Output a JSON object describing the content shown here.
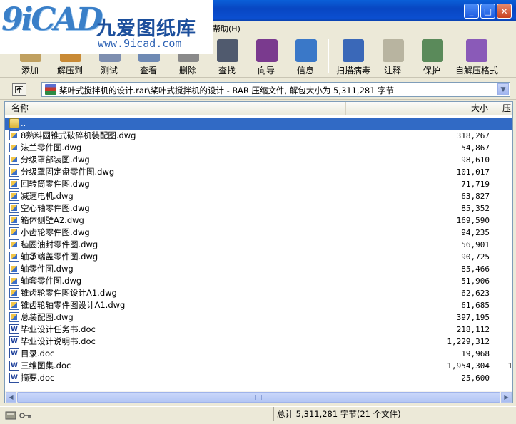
{
  "menu": {
    "help_label": "帮助(H)"
  },
  "logo": {
    "cn_text": "九爱图纸库",
    "url": "www.9icad.com",
    "mark": "9iCAD"
  },
  "window_buttons": {
    "minimize": "_",
    "maximize": "□",
    "close": "✕"
  },
  "toolbar": [
    {
      "label": "添加",
      "icon": "add-archive-icon",
      "color": "#c0a060"
    },
    {
      "label": "解压到",
      "icon": "extract-to-icon",
      "color": "#c98a35"
    },
    {
      "label": "测试",
      "icon": "test-icon",
      "color": "#7e8fb0"
    },
    {
      "label": "查看",
      "icon": "view-icon",
      "color": "#6f8ab4"
    },
    {
      "label": "删除",
      "icon": "delete-icon",
      "color": "#8a8a8a"
    },
    {
      "label": "查找",
      "icon": "find-icon",
      "color": "#505a6e"
    },
    {
      "label": "向导",
      "icon": "wizard-icon",
      "color": "#7a3a8e"
    },
    {
      "label": "信息",
      "icon": "info-icon",
      "color": "#3a78c8"
    },
    {
      "label": "扫描病毒",
      "icon": "virus-scan-icon",
      "color": "#3a68b8"
    },
    {
      "label": "注释",
      "icon": "comment-icon",
      "color": "#b8b4a0"
    },
    {
      "label": "保护",
      "icon": "protect-icon",
      "color": "#5a8a5a"
    },
    {
      "label": "自解压格式",
      "icon": "sfx-icon",
      "color": "#8a5ab8"
    }
  ],
  "address": {
    "path": "桨叶式搅拌机的设计.rar\\桨叶式搅拌机的设计 - RAR 压缩文件, 解包大小为 5,311,281 字节"
  },
  "columns": {
    "name": "名称",
    "size": "大小",
    "packed": "压"
  },
  "files": [
    {
      "name": "..",
      "size": "",
      "packed": "",
      "type": "folder",
      "selected": true
    },
    {
      "name": "8熟料圆锥式破碎机装配图.dwg",
      "size": "318,267",
      "packed": "",
      "type": "dwg"
    },
    {
      "name": "法兰零件图.dwg",
      "size": "54,867",
      "packed": "",
      "type": "dwg"
    },
    {
      "name": "分级罩部装图.dwg",
      "size": "98,610",
      "packed": "",
      "type": "dwg"
    },
    {
      "name": "分级罩固定盘零件图.dwg",
      "size": "101,017",
      "packed": "",
      "type": "dwg"
    },
    {
      "name": "回转筒零件图.dwg",
      "size": "71,719",
      "packed": "",
      "type": "dwg"
    },
    {
      "name": "减速电机.dwg",
      "size": "63,827",
      "packed": "",
      "type": "dwg"
    },
    {
      "name": "空心轴零件图.dwg",
      "size": "85,352",
      "packed": "",
      "type": "dwg"
    },
    {
      "name": "箱体侧壁A2.dwg",
      "size": "169,590",
      "packed": "",
      "type": "dwg"
    },
    {
      "name": "小齿轮零件图.dwg",
      "size": "94,235",
      "packed": "",
      "type": "dwg"
    },
    {
      "name": "毡圈油封零件图.dwg",
      "size": "56,901",
      "packed": "",
      "type": "dwg"
    },
    {
      "name": "轴承端盖零件图.dwg",
      "size": "90,725",
      "packed": "",
      "type": "dwg"
    },
    {
      "name": "轴零件图.dwg",
      "size": "85,466",
      "packed": "",
      "type": "dwg"
    },
    {
      "name": "轴套零件图.dwg",
      "size": "51,906",
      "packed": "",
      "type": "dwg"
    },
    {
      "name": "锥齿轮零件图设计A1.dwg",
      "size": "62,623",
      "packed": "",
      "type": "dwg"
    },
    {
      "name": "锥齿轮轴零件图设计A1.dwg",
      "size": "61,685",
      "packed": "",
      "type": "dwg"
    },
    {
      "name": "总装配图.dwg",
      "size": "397,195",
      "packed": "",
      "type": "dwg"
    },
    {
      "name": "毕业设计任务书.doc",
      "size": "218,112",
      "packed": "",
      "type": "doc"
    },
    {
      "name": "毕业设计说明书.doc",
      "size": "1,229,312",
      "packed": "",
      "type": "doc"
    },
    {
      "name": "目录.doc",
      "size": "19,968",
      "packed": "",
      "type": "doc"
    },
    {
      "name": "三维图集.doc",
      "size": "1,954,304",
      "packed": "1",
      "type": "doc"
    },
    {
      "name": "摘要.doc",
      "size": "25,600",
      "packed": "",
      "type": "doc"
    }
  ],
  "status": {
    "text": "总计 5,311,281 字节(21 个文件)"
  }
}
